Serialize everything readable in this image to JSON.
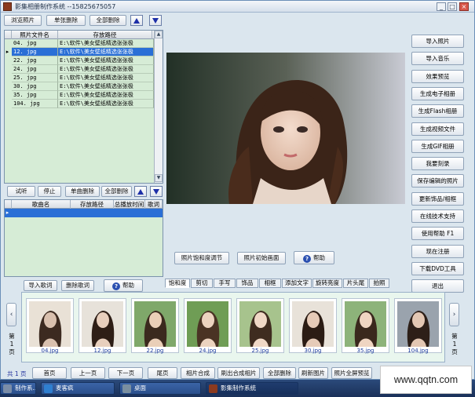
{
  "window": {
    "title": "影集相册制作系统  --15825675057",
    "buttons": {
      "minimize": "_",
      "maximize": "□",
      "close": "×"
    }
  },
  "photo_toolbar": {
    "browse": "浏览照片",
    "delete_one": "单张删除",
    "delete_all": "全部删除",
    "up_icon": "arrow-up-icon",
    "down_icon": "arrow-down-icon"
  },
  "photo_grid": {
    "headers": [
      "照片文件名",
      "存放路径"
    ],
    "rows": [
      {
        "name": "04. jpg",
        "path": "E:\\软件\\美女壁纸精选张张极"
      },
      {
        "name": "12. jpg",
        "path": "E:\\软件\\美女壁纸精选张张极"
      },
      {
        "name": "22. jpg",
        "path": "E:\\软件\\美女壁纸精选张张极"
      },
      {
        "name": "24. jpg",
        "path": "E:\\软件\\美女壁纸精选张张极"
      },
      {
        "name": "25. jpg",
        "path": "E:\\软件\\美女壁纸精选张张极"
      },
      {
        "name": "30. jpg",
        "path": "E:\\软件\\美女壁纸精选张张极"
      },
      {
        "name": "35. jpg",
        "path": "E:\\软件\\美女壁纸精选张张极"
      },
      {
        "name": "104. jpg",
        "path": "E:\\软件\\美女壁纸精选张张极"
      }
    ],
    "selected_index": 1
  },
  "music_toolbar": {
    "listen": "试听",
    "stop": "停止",
    "delete_one": "单曲删除",
    "delete_all": "全部删除"
  },
  "music_grid": {
    "headers": [
      "歌曲名",
      "存放路径",
      "总播放时间",
      "歌词"
    ]
  },
  "lyrics_buttons": {
    "import": "导入歌词",
    "delete": "删除歌词",
    "help": "帮助"
  },
  "viewer_buttons": {
    "adjust": "照片饱和度调节",
    "initial": "照片初始画面",
    "help": "帮助"
  },
  "right_buttons": [
    "导入照片",
    "导入音乐",
    "效果预览",
    "生成电子相册",
    "生成Flash相册",
    "生成视频文件",
    "生成GIF相册",
    "我要刻录",
    "保存编辑的照片",
    "更新饰品/相框",
    "在线技术支持",
    "使用帮助  F1",
    "现在注册",
    "下载DVD工具",
    "退出"
  ],
  "tabs": [
    "饱和度",
    "剪切",
    "手写",
    "饰品",
    "相框",
    "添加文字",
    "旋转亮度",
    "片头尾",
    "拍照"
  ],
  "thumbnails": [
    "04.jpg",
    "12.jpg",
    "22.jpg",
    "24.jpg",
    "25.jpg",
    "30.jpg",
    "35.jpg",
    "104.jpg"
  ],
  "nav": {
    "left_arrow": "‹",
    "right_arrow": "›",
    "left_label": "第\n1\n页",
    "right_label": "第\n1\n页"
  },
  "bottom": {
    "page_total": "共 1 页",
    "buttons": [
      "首页",
      "上一页",
      "下一页",
      "尾页",
      "相片合成",
      "刷出合成相片",
      "全部删除",
      "刷新图片",
      "照片全屏预览"
    ]
  },
  "taskbar": {
    "items": [
      "制作系...",
      "麦客疯",
      "桌面",
      "影集制作系统"
    ]
  },
  "watermark": "www.qqtn.com",
  "colors": {
    "selection": "#2a6fd6",
    "grid_bg": "#d6ecd6",
    "arrow_blue": "#1d2fa8"
  }
}
